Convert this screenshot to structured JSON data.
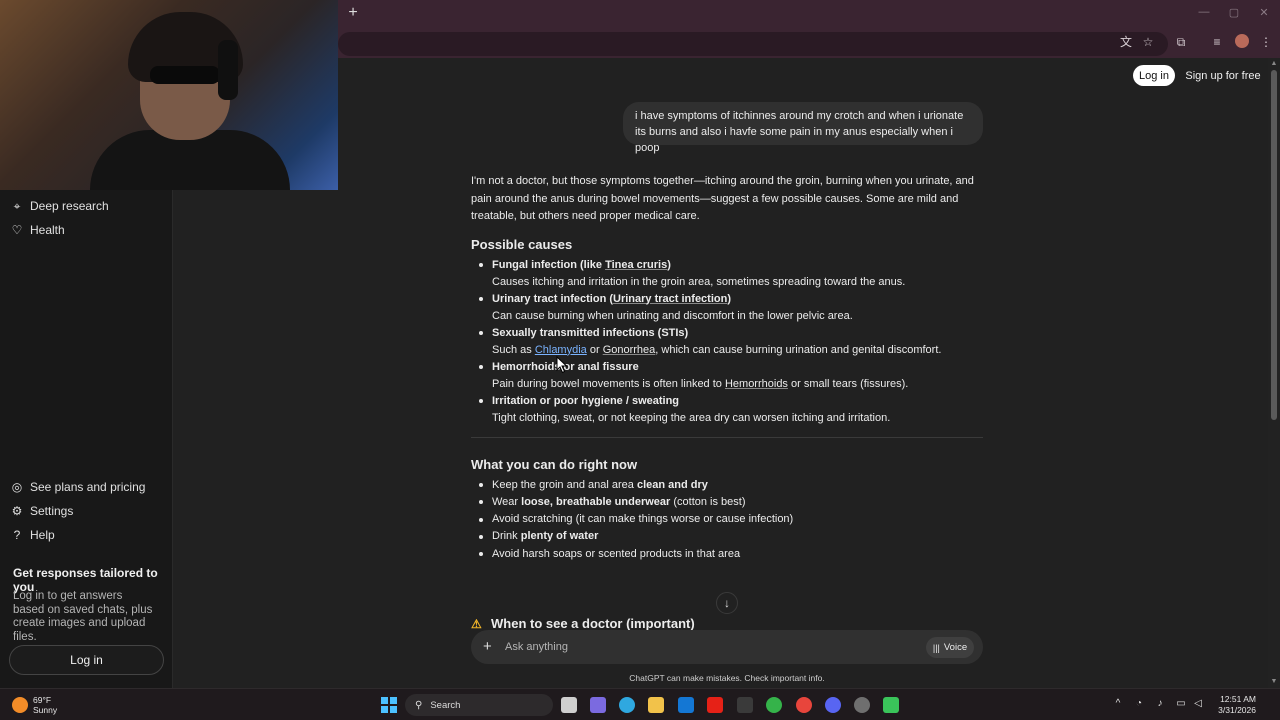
{
  "sidebar": {
    "items_top": [
      {
        "label": "Deep research",
        "icon": "telescope-icon"
      },
      {
        "label": "Health",
        "icon": "heart-icon"
      }
    ],
    "items_bottom": [
      {
        "label": "See plans and pricing",
        "icon": "plans-icon"
      },
      {
        "label": "Settings",
        "icon": "gear-icon"
      },
      {
        "label": "Help",
        "icon": "help-icon"
      }
    ],
    "promo_title": "Get responses tailored to you",
    "promo_text": "Log in to get answers based on saved chats, plus create images and upload files.",
    "login_label": "Log in"
  },
  "header": {
    "login_label": "Log in",
    "signup_label": "Sign up for free"
  },
  "conversation": {
    "user_message": "i have symptoms of itchinnes around my crotch and when i urionate its burns and also i havfe some pain in my anus especially when i poop",
    "intro": "I'm not a doctor, but those symptoms together—itching around the groin, burning when you urinate, and pain around the anus during bowel movements—suggest a few possible causes. Some are mild and treatable, but others need proper medical care.",
    "causes_heading": "Possible causes",
    "causes": [
      {
        "title_a": "Fungal infection (like ",
        "title_link": "Tinea cruris",
        "title_b": ")",
        "desc": "Causes itching and irritation in the groin area, sometimes spreading toward the anus."
      },
      {
        "title_a": "Urinary tract infection (",
        "title_link": "Urinary tract infection",
        "title_b": ")",
        "desc": "Can cause burning when urinating and discomfort in the lower pelvic area."
      },
      {
        "title": "Sexually transmitted infections (STIs)",
        "desc_a": "Such as ",
        "desc_link1": "Chlamydia",
        "desc_mid": " or ",
        "desc_link2": "Gonorrhea",
        "desc_b": ", which can cause burning urination and genital discomfort."
      },
      {
        "title": "Hemorrhoids or anal fissure",
        "desc_a": "Pain during bowel movements is often linked to ",
        "desc_link": "Hemorrhoids",
        "desc_b": " or small tears (fissures)."
      },
      {
        "title": "Irritation or poor hygiene / sweating",
        "desc": "Tight clothing, sweat, or not keeping the area dry can worsen itching and irritation."
      }
    ],
    "now_heading": "What you can do right now",
    "now_items": [
      {
        "a": "Keep the groin and anal area ",
        "b": "clean and dry",
        "c": ""
      },
      {
        "a": "Wear ",
        "b": "loose, breathable underwear",
        "c": " (cotton is best)"
      },
      {
        "a": "Avoid scratching (it can make things worse or cause infection)",
        "b": "",
        "c": ""
      },
      {
        "a": "Drink ",
        "b": "plenty of water",
        "c": ""
      },
      {
        "a": "Avoid harsh soaps or scented products in that area",
        "b": "",
        "c": ""
      }
    ],
    "doctor_heading": "When to see a doctor (important)"
  },
  "composer": {
    "placeholder": "Ask anything",
    "voice_label": "Voice",
    "disclaimer": "ChatGPT can make mistakes. Check important info."
  },
  "taskbar": {
    "weather_temp": "69°F",
    "weather_desc": "Sunny",
    "search_label": "Search",
    "time": "12:51 AM",
    "date": "3/31/2026"
  },
  "colors": {
    "browser_frame": "#3a2431",
    "page_bg": "#212121",
    "sidebar_bg": "#181818",
    "link": "#7ab3ff",
    "warning": "#f0b429"
  }
}
